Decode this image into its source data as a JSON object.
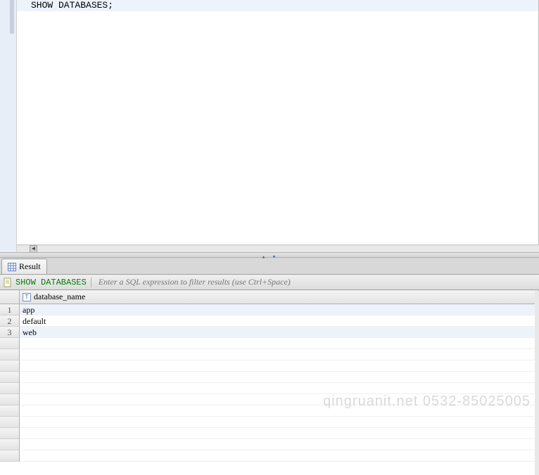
{
  "editor": {
    "line1_keyword": "SHOW DATABASES",
    "line1_semi": ";"
  },
  "tabs": {
    "result": "Result"
  },
  "toolbar": {
    "sql_label": "SHOW DATABASES",
    "filter_placeholder": "Enter a SQL expression to filter results (use Ctrl+Space)"
  },
  "grid": {
    "column_header": "database_name",
    "type_glyph": "T",
    "rows": [
      {
        "n": "1",
        "v": "app"
      },
      {
        "n": "2",
        "v": "default"
      },
      {
        "n": "3",
        "v": "web"
      }
    ]
  },
  "watermark": "qingruanit.net 0532-85025005",
  "icons": {
    "hscroll_left": "◄",
    "splitter": "▴ ▾"
  }
}
